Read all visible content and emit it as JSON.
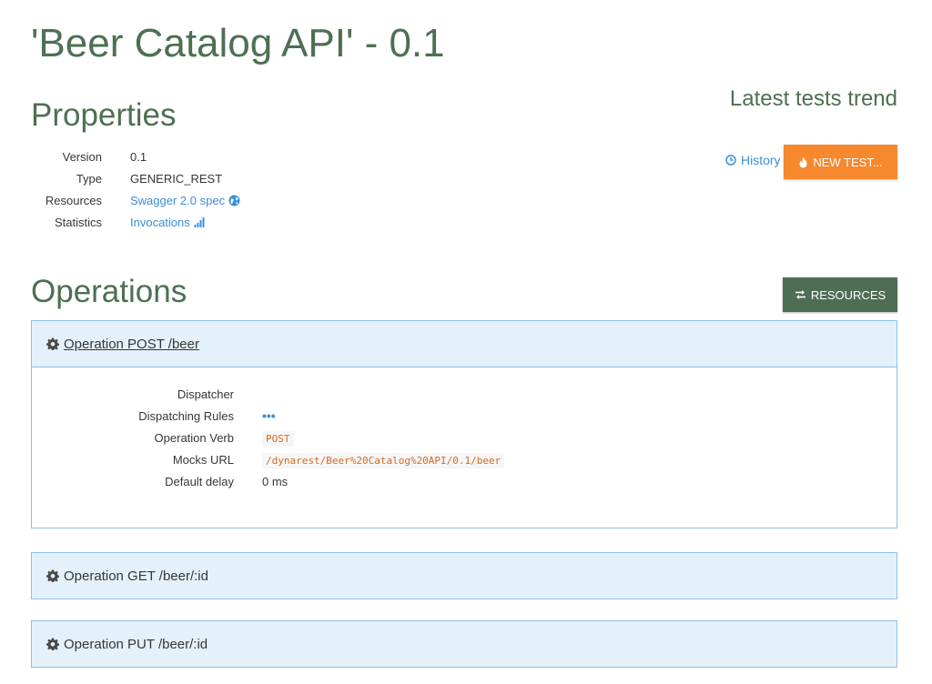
{
  "header": {
    "title": "'Beer Catalog API' - 0.1"
  },
  "properties": {
    "heading": "Properties",
    "rows": [
      {
        "label": "Version",
        "value": "0.1"
      },
      {
        "label": "Type",
        "value": "GENERIC_REST"
      },
      {
        "label": "Resources",
        "value": "Swagger 2.0 spec",
        "icon": "globe-icon"
      },
      {
        "label": "Statistics",
        "value": "Invocations",
        "icon": "bar-chart-icon"
      }
    ]
  },
  "tests": {
    "heading": "Latest tests trend",
    "history_label": "History",
    "history_icon": "clock-icon",
    "new_test_label": "NEW TEST...",
    "new_test_icon": "fire-icon",
    "new_test_color": "#f6892e"
  },
  "operations": {
    "heading": "Operations",
    "resources_button_label": "RESOURCES",
    "resources_button_icon": "exchange-icon",
    "resources_button_color": "#4d6e52",
    "items": [
      {
        "title": "Operation POST /beer",
        "expanded": true,
        "details": {
          "dispatcher_label": "Dispatcher",
          "dispatcher_value": "",
          "rules_label": "Dispatching Rules",
          "rules_value": "•••",
          "verb_label": "Operation Verb",
          "verb_value": "POST",
          "mocks_label": "Mocks URL",
          "mocks_value": "/dynarest/Beer%20Catalog%20API/0.1/beer",
          "delay_label": "Default delay",
          "delay_value": "0 ms"
        }
      },
      {
        "title": "Operation GET /beer/:id",
        "expanded": false
      },
      {
        "title": "Operation PUT /beer/:id",
        "expanded": false
      }
    ]
  },
  "colors": {
    "heading_green": "#4d7052",
    "link_blue": "#3a8fd6",
    "panel_heading_bg": "#e5f1fa",
    "panel_border": "#8cc0e8"
  }
}
